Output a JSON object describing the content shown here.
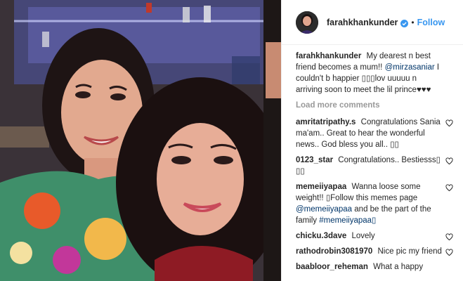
{
  "post": {
    "username": "farahkhankunder",
    "follow_label": "Follow",
    "separator": "•"
  },
  "caption": {
    "username": "farahkhankunder",
    "text_before": "My dearest n best friend becomes a mum!!",
    "mention": "@mirzasaniar",
    "text_after": "I couldn't b happier ▯▯▯lov uuuuu n arriving soon to meet the lil prince♥♥♥"
  },
  "load_more_label": "Load more comments",
  "comments": [
    {
      "username": "amritatripathy.s",
      "text": "Congratulations Sania ma'am.. Great to hear the wonderful news.. God bless you all.. ▯▯"
    },
    {
      "username": "0123_star",
      "text": "Congratulations.. Bestiesss▯ ▯▯"
    },
    {
      "username": "memeiiyapaa",
      "text": "Wanna loose some weight!! ▯Follow this memes page",
      "link1": "@memeiiyapaa",
      "text2": "and be the part of the family",
      "link2": "#memeiiyapaa▯"
    },
    {
      "username": "chicku.3dave",
      "text": "Lovely"
    },
    {
      "username": "rathodrobin3081970",
      "text": "Nice pic my friend"
    },
    {
      "username": "baabloor_reheman",
      "text": "What a happy"
    }
  ],
  "colors": {
    "link": "#003569",
    "follow": "#3897f0",
    "muted": "#999999",
    "text": "#262626"
  },
  "icons": [
    "verified-badge-icon",
    "heart-icon"
  ]
}
